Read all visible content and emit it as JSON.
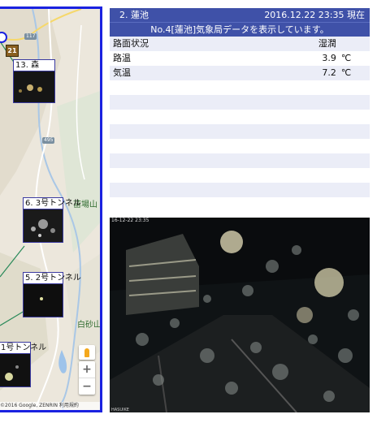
{
  "map": {
    "cameras": [
      {
        "label": "13. 森"
      },
      {
        "label": "6. 3号トンネル"
      },
      {
        "label": "5. 2号トンネル"
      },
      {
        "label": "1号トンネル"
      }
    ],
    "place_labels": {
      "naebayama": "苗場山",
      "shirasuna": "白砂山"
    },
    "route_shields": {
      "r117": "117",
      "r495": "495"
    },
    "route_sign": "21",
    "zoom_in": "+",
    "zoom_out": "−",
    "attribution": "©2016 Google, ZENRIN   利用規約",
    "colors": {
      "frame": "#1a22e0",
      "route_line": "#2a8a5a"
    }
  },
  "station": {
    "name": "2. 蓮池",
    "timestamp": "2016.12.22  23:35  現在",
    "notice": "No.4[蓮池]気象局データを表示しています。",
    "rows": [
      {
        "label": "路面状況",
        "value": "湿潤",
        "unit": ""
      },
      {
        "label": "路温",
        "value": "3.9",
        "unit": "℃"
      },
      {
        "label": "気温",
        "value": "7.2",
        "unit": "℃"
      },
      {
        "label": "",
        "value": "",
        "unit": ""
      },
      {
        "label": "",
        "value": "",
        "unit": ""
      },
      {
        "label": "",
        "value": "",
        "unit": ""
      },
      {
        "label": "",
        "value": "",
        "unit": ""
      },
      {
        "label": "",
        "value": "",
        "unit": ""
      },
      {
        "label": "",
        "value": "",
        "unit": ""
      },
      {
        "label": "",
        "value": "",
        "unit": ""
      },
      {
        "label": "",
        "value": "",
        "unit": ""
      }
    ],
    "colors": {
      "header": "#3f51a8",
      "row_alt": "#ebedf7"
    }
  },
  "camera": {
    "stamp": "16-12-22  23:35",
    "footer": "HASUIKE"
  }
}
